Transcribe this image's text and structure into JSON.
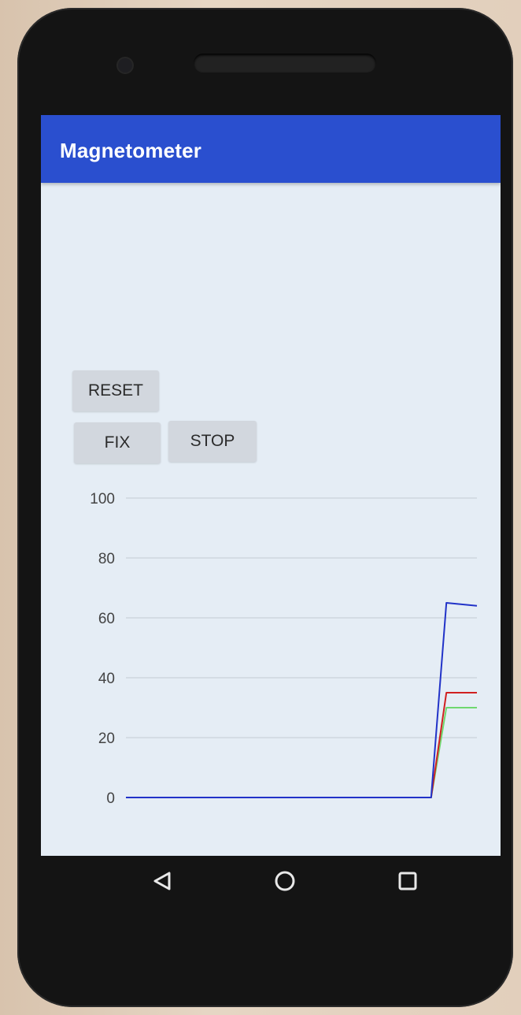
{
  "app": {
    "title": "Magnetometer"
  },
  "buttons": {
    "reset": "RESET",
    "fix": "FIX",
    "stop": "STOP"
  },
  "colors": {
    "appbar": "#2a4fcf",
    "screen": "#e5edf5",
    "series_blue": "#2233c8",
    "series_red": "#d02020",
    "series_green": "#6fd86f"
  },
  "chart_data": {
    "type": "line",
    "yticks": [
      "100",
      "80",
      "60",
      "40",
      "20",
      "0"
    ],
    "ylim": [
      0,
      100
    ],
    "grid": true,
    "series": [
      {
        "color": "#6fd86f",
        "x": [
          0,
          100,
          105,
          115
        ],
        "values": [
          0,
          0,
          30,
          30
        ]
      },
      {
        "color": "#d02020",
        "x": [
          0,
          100,
          105,
          115
        ],
        "values": [
          0,
          0,
          35,
          35
        ]
      },
      {
        "color": "#2233c8",
        "x": [
          0,
          100,
          105,
          115
        ],
        "values": [
          0,
          0,
          65,
          64
        ]
      }
    ]
  },
  "navigation": {
    "back": "back-icon",
    "home": "home-icon",
    "recents": "recents-icon"
  }
}
